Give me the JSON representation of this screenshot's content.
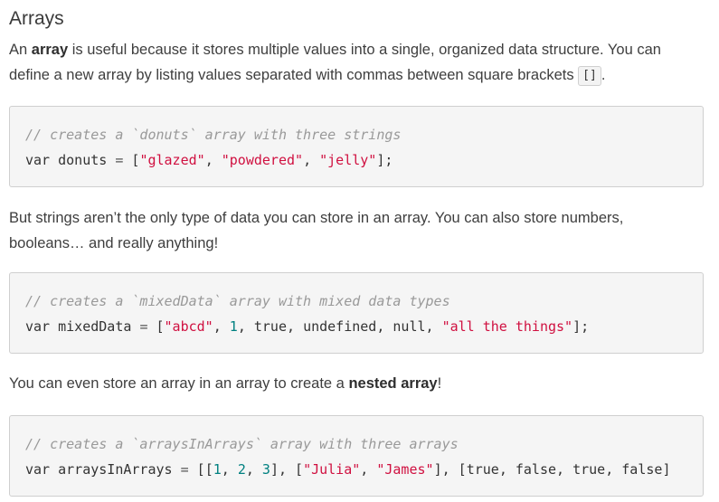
{
  "heading": "Arrays",
  "intro": {
    "pre": "An ",
    "bold": "array",
    "mid": " is useful because it stores multiple values into a single, organized data structure. You can define a new array by listing values separated with commas between square brackets ",
    "code": "[]",
    "post": "."
  },
  "code1": {
    "comment": "// creates a `donuts` array with three strings",
    "var_keyword": "var",
    "var_name": "donuts",
    "assign": "=",
    "open": "[",
    "strings": [
      "\"glazed\"",
      "\"powdered\"",
      "\"jelly\""
    ],
    "sep": ",",
    "close": "];"
  },
  "para2": "But strings aren’t the only type of data you can store in an array. You can also store numbers, booleans… and really anything!",
  "code2": {
    "comment": "// creates a `mixedData` array with mixed data types",
    "var_keyword": "var",
    "var_name": "mixedData",
    "assign": "=",
    "open": "[",
    "str1": "\"abcd\"",
    "num1": "1",
    "lit1": "true",
    "lit2": "undefined",
    "lit3": "null",
    "str2": "\"all the things\"",
    "sep": ",",
    "close": "];"
  },
  "para3": {
    "pre": "You can even store an array in an array to create a ",
    "bold": "nested array",
    "post": "!"
  },
  "code3": {
    "comment": "// creates a `arraysInArrays` array with three arrays",
    "var_keyword": "var",
    "var_name": "arraysInArrays",
    "assign": "=",
    "open_outer": "[",
    "open": "[",
    "nums": [
      "1",
      "2",
      "3"
    ],
    "close_inner": "]",
    "sep": ",",
    "str1": "\"Julia\"",
    "str2": "\"James\"",
    "bools": [
      "true",
      "false",
      "true",
      "false"
    ],
    "tail": "]"
  }
}
